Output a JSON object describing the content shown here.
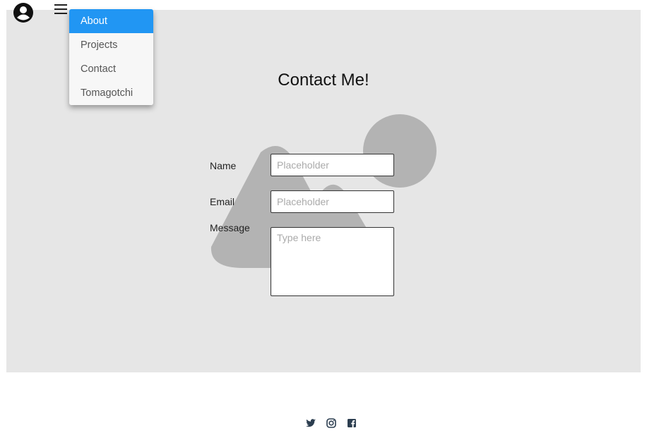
{
  "nav": {
    "avatar_icon": "account-circle-icon",
    "menu_icon": "hamburger-menu-icon",
    "menu_items": [
      {
        "label": "About",
        "active": true
      },
      {
        "label": "Projects",
        "active": false
      },
      {
        "label": "Contact",
        "active": false
      },
      {
        "label": "Tomagotchi",
        "active": false
      }
    ]
  },
  "main": {
    "title": "Contact Me!",
    "form": {
      "name_label": "Name",
      "name_placeholder": "Placeholder",
      "email_label": "Email",
      "email_placeholder": "Placeholder",
      "message_label": "Message",
      "message_placeholder": "Type here"
    }
  },
  "footer": {
    "social": [
      "twitter-icon",
      "instagram-icon",
      "facebook-icon"
    ]
  },
  "colors": {
    "hero_bg": "#e6e6e6",
    "placeholder_shape": "#b3b3b3",
    "menu_active": "#2196f3",
    "icon_dark": "#2c3e50"
  }
}
